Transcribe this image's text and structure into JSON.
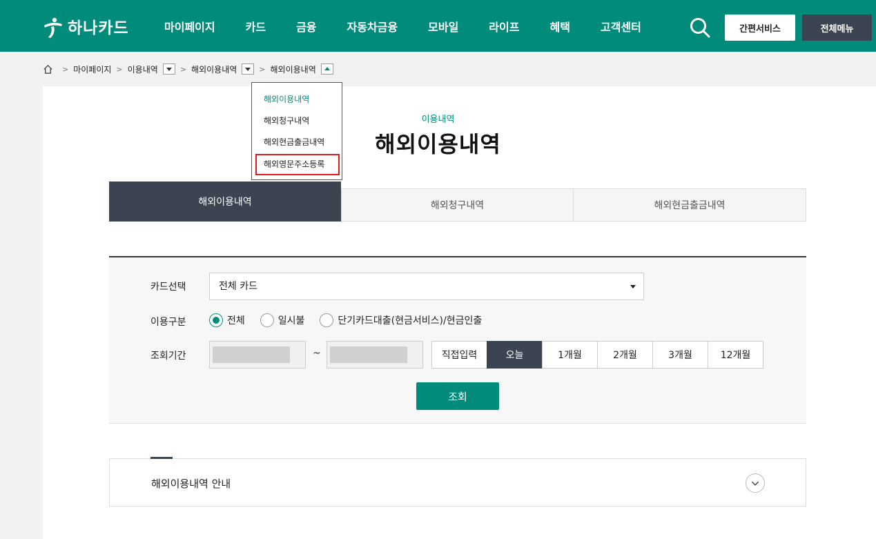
{
  "header": {
    "logo_text": "하나카드",
    "nav": [
      "마이페이지",
      "카드",
      "금융",
      "자동차금융",
      "모바일",
      "라이프",
      "혜택",
      "고객센터"
    ],
    "easy_service_label": "간편서비스",
    "all_menu_label": "전체메뉴",
    "brand_color": "#008b7b"
  },
  "breadcrumb": {
    "items": [
      "마이페이지",
      "이용내역",
      "해외이용내역",
      "해외이용내역"
    ]
  },
  "dropdown": {
    "items": [
      "해외이용내역",
      "해외청구내역",
      "해외현금출금내역",
      "해외영문주소등록"
    ]
  },
  "page": {
    "sub_title": "이용내역",
    "title": "해외이용내역"
  },
  "tabs": [
    "해외이용내역",
    "해외청구내역",
    "해외현금출금내역"
  ],
  "filter": {
    "card_label": "카드선택",
    "card_value": "전체 카드",
    "type_label": "이용구분",
    "type_options": [
      "전체",
      "일시불",
      "단기카드대출(현금서비스)/현금인출"
    ],
    "type_selected": "전체",
    "period_label": "조회기간",
    "date_separator": "~",
    "period_buttons": [
      "직접입력",
      "오늘",
      "1개월",
      "2개월",
      "3개월",
      "12개월"
    ],
    "period_selected": "오늘",
    "submit_label": "조회"
  },
  "info": {
    "title": "해외이용내역 안내"
  }
}
